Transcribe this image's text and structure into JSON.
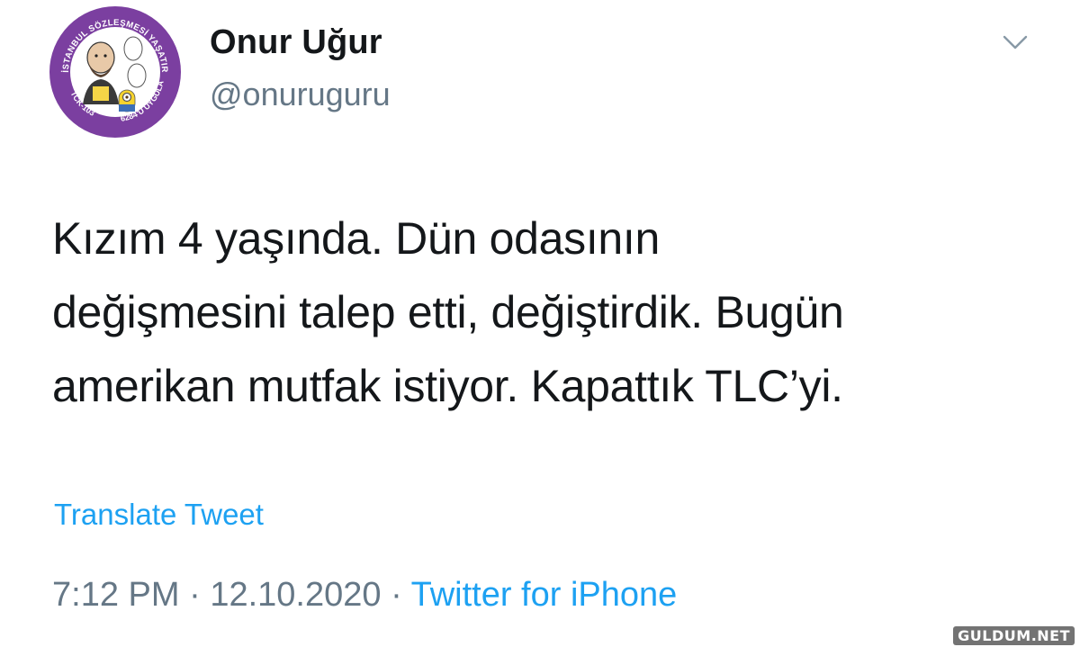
{
  "tweet": {
    "author": {
      "display_name": "Onur Uğur",
      "handle": "@onuruguru",
      "avatar_badge_top": "İSTANBUL SÖZLEŞMESİ YAŞATIR",
      "avatar_badge_left": "TCK-103",
      "avatar_badge_right": "6284'Ü UYGULA"
    },
    "text": "Kızım 4 yaşında. Dün odasının\ndeğişmesini talep etti, değiştirdik. Bugün\namerikan mutfak istiyor. Kapattık TLC’yi.",
    "translate_label": "Translate Tweet",
    "time": "7:12 PM",
    "date": "12.10.2020",
    "separator": "·",
    "source": "Twitter for iPhone"
  },
  "icons": {
    "menu": "chevron-down-icon"
  },
  "colors": {
    "accent": "#1da1f2",
    "secondary_text": "#657786",
    "primary_text": "#14171a",
    "avatar_ring": "#7b3fa0"
  },
  "watermark": "GULDUM.NET"
}
